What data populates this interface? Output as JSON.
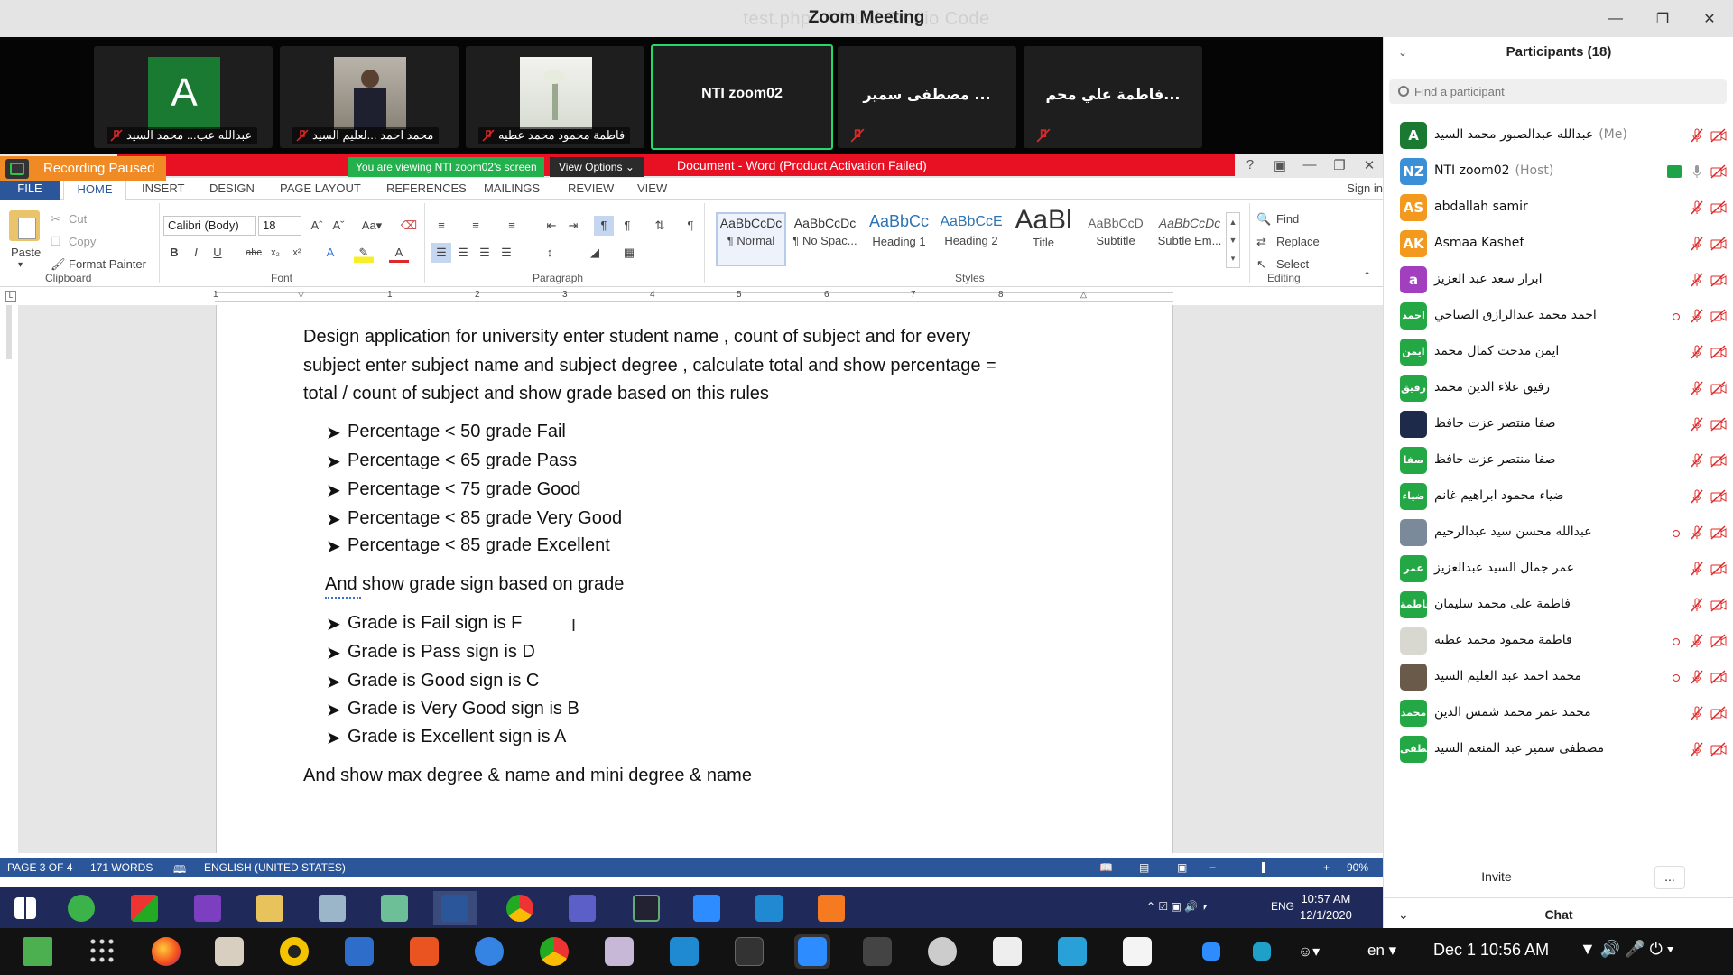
{
  "zoom": {
    "title_behind": "test.php - Visual Studio Code",
    "title": "Zoom Meeting",
    "thumbnails": [
      {
        "label": "عبدالله عب... محمد السيد",
        "avatar_letter": "A",
        "avatar_color": "#1a7a31"
      },
      {
        "label": "محمد احمد ...لعليم السيد"
      },
      {
        "label": "فاطمة محمود محمد عطيه"
      },
      {
        "name": "NTI zoom02"
      },
      {
        "name": "مصطفى سمير ..."
      },
      {
        "name": "فاطمة علي محم..."
      }
    ],
    "recording_paused": "Recording Paused",
    "viewing_banner": "You are viewing NTI zoom02's screen",
    "view_options": "View Options"
  },
  "word": {
    "title": "Document -  Word (Product Activation Failed)",
    "tabs": [
      "FILE",
      "HOME",
      "INSERT",
      "DESIGN",
      "PAGE LAYOUT",
      "REFERENCES",
      "MAILINGS",
      "REVIEW",
      "VIEW"
    ],
    "sign_in": "Sign in",
    "clipboard": {
      "paste": "Paste",
      "cut": "Cut",
      "copy": "Copy",
      "format_painter": "Format Painter",
      "label": "Clipboard"
    },
    "font": {
      "name": "Calibri (Body)",
      "size": "18",
      "label": "Font"
    },
    "paragraph_label": "Paragraph",
    "styles": [
      {
        "sample": "AaBbCcDc",
        "name": "¶ Normal"
      },
      {
        "sample": "AaBbCcDc",
        "name": "¶ No Spac..."
      },
      {
        "sample": "AaBbCc",
        "name": "Heading 1"
      },
      {
        "sample": "AaBbCcE",
        "name": "Heading 2"
      },
      {
        "sample": "AaBl",
        "name": "Title"
      },
      {
        "sample": "AaBbCcD",
        "name": "Subtitle"
      },
      {
        "sample": "AaBbCcDc",
        "name": "Subtle Em..."
      }
    ],
    "styles_label": "Styles",
    "editing": {
      "find": "Find",
      "replace": "Replace",
      "select": "Select",
      "label": "Editing"
    },
    "ruler_numbers": [
      "1",
      "1",
      "2",
      "3",
      "4",
      "5",
      "6",
      "7",
      "8"
    ],
    "document": {
      "intro": [
        "Design application for university enter student name ,  count of subject and for every",
        "subject enter subject name and subject degree , calculate total and show percentage =",
        "total / count of subject and show grade based on this rules"
      ],
      "rules": [
        "Percentage < 50 grade Fail",
        "Percentage < 65 grade Pass",
        "Percentage < 75 grade Good",
        "Percentage < 85 grade Very Good",
        "Percentage < 85 grade Excellent"
      ],
      "sign_intro": "And show grade sign based on grade",
      "signs": [
        "Grade is Fail sign is F",
        "Grade is Pass sign is D",
        "Grade is Good sign is C",
        "Grade is Very Good sign is B",
        "Grade is Excellent sign is A"
      ],
      "outro": "And show max degree & name and mini degree & name"
    },
    "status": {
      "page": "PAGE 3 OF 4",
      "words": "171 WORDS",
      "language": "ENGLISH (UNITED STATES)",
      "zoom": "90%"
    }
  },
  "win_taskbar": {
    "lang": "ENG",
    "time": "10:57 AM",
    "date": "12/1/2020"
  },
  "participants": {
    "title": "Participants (18)",
    "search_placeholder": "Find a participant",
    "list": [
      {
        "initials": "A",
        "color": "#1a7a31",
        "name": "عبدالله عبدالصبور محمد السيد",
        "tag": "(Me)"
      },
      {
        "initials": "NZ",
        "color": "#3a8fd6",
        "name": "NTI zoom02",
        "tag": "(Host)"
      },
      {
        "initials": "AS",
        "color": "#f39a1e",
        "name": "abdallah samir"
      },
      {
        "initials": "AK",
        "color": "#f39a1e",
        "name": "Asmaa Kashef"
      },
      {
        "initials": "a",
        "color": "#a13fbf",
        "name": "ابرار سعد عبد العزيز"
      },
      {
        "initials": "احمد",
        "color": "#23a845",
        "name": "احمد محمد عبدالرازق الصباحي"
      },
      {
        "initials": "ايمن",
        "color": "#23a845",
        "name": "ايمن مدحت كمال محمد"
      },
      {
        "initials": "رفيق",
        "color": "#23a845",
        "name": "رفيق علاء الدين محمد"
      },
      {
        "initials": "",
        "color": "#1d2a4a",
        "name": "صفا منتصر عزت حافظ"
      },
      {
        "initials": "صفا",
        "color": "#23a845",
        "name": "صفا منتصر عزت حافظ"
      },
      {
        "initials": "ضياء",
        "color": "#23a845",
        "name": "ضياء محمود ابراهيم غانم"
      },
      {
        "initials": "",
        "color": "#7a8a9a",
        "name": "عبدالله محسن سيد عبدالرحيم"
      },
      {
        "initials": "عمر",
        "color": "#23a845",
        "name": "عمر جمال السيد عبدالعزيز"
      },
      {
        "initials": "فاطمة",
        "color": "#23a845",
        "name": "فاطمة على محمد سليمان"
      },
      {
        "initials": "",
        "color": "#d8d8d0",
        "name": "فاطمة محمود محمد عطيه"
      },
      {
        "initials": "",
        "color": "#6a5a4a",
        "name": "محمد احمد عبد العليم السيد"
      },
      {
        "initials": "محمد",
        "color": "#23a845",
        "name": "محمد عمر محمد شمس الدين"
      },
      {
        "initials": "مصطفى",
        "color": "#23a845",
        "name": "مصطفى سمير عبد المنعم السيد"
      }
    ],
    "invite": "Invite",
    "more": "...",
    "chat": "Chat"
  },
  "dock": {
    "lang": "en",
    "clock": "Dec 1  10:56 AM"
  }
}
